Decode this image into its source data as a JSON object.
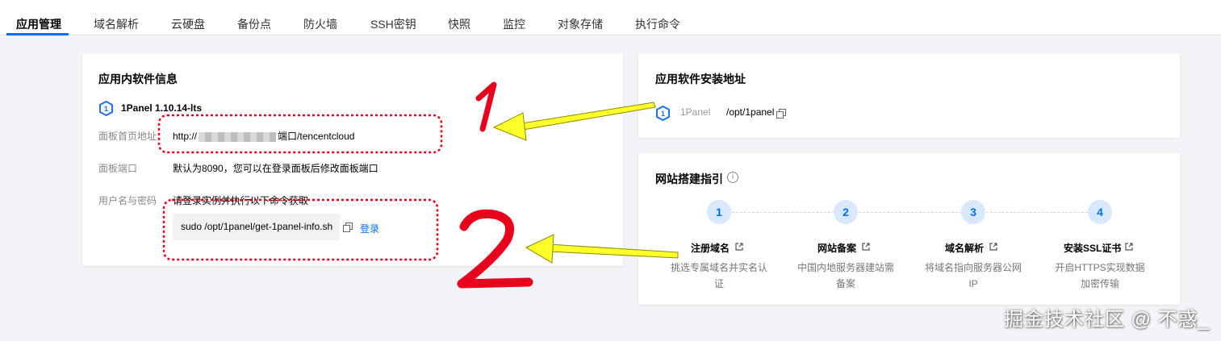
{
  "tabs": [
    "应用管理",
    "域名解析",
    "云硬盘",
    "备份点",
    "防火墙",
    "SSH密钥",
    "快照",
    "监控",
    "对象存储",
    "执行命令"
  ],
  "left_card": {
    "title": "应用内软件信息",
    "app_name": "1Panel 1.10.14-lts",
    "rows": {
      "panel_url_label": "面板首页地址",
      "panel_url_prefix": "http://",
      "panel_url_suffix": "端口/tencentcloud",
      "panel_port_label": "面板端口",
      "panel_port_value": "默认为8090，您可以在登录面板后修改面板端口",
      "credentials_label": "用户名与密码",
      "credentials_hint": "请登录实例并执行以下命令获取",
      "command": "sudo /opt/1panel/get-1panel-info.sh",
      "login_link": "登录"
    }
  },
  "install_card": {
    "title": "应用软件安装地址",
    "app": "1Panel",
    "path": "/opt/1panel"
  },
  "guide_card": {
    "title": "网站搭建指引",
    "info_icon": "info-icon",
    "steps": [
      {
        "num": "1",
        "title": "注册域名",
        "desc": "挑选专属域名并实名认证"
      },
      {
        "num": "2",
        "title": "网站备案",
        "desc": "中国内地服务器建站需备案"
      },
      {
        "num": "3",
        "title": "域名解析",
        "desc": "将域名指向服务器公网IP"
      },
      {
        "num": "4",
        "title": "安装SSL证书",
        "desc": "开启HTTPS实现数据加密传输"
      }
    ]
  },
  "annotations": {
    "one": "1",
    "two": "2"
  },
  "watermark": "掘金技术社区 @ 不惑_",
  "colors": {
    "accent": "#006eff",
    "annotation_red": "#e8001c",
    "arrow_yellow": "#ffff2a",
    "step_bg": "#d8e8ff"
  }
}
